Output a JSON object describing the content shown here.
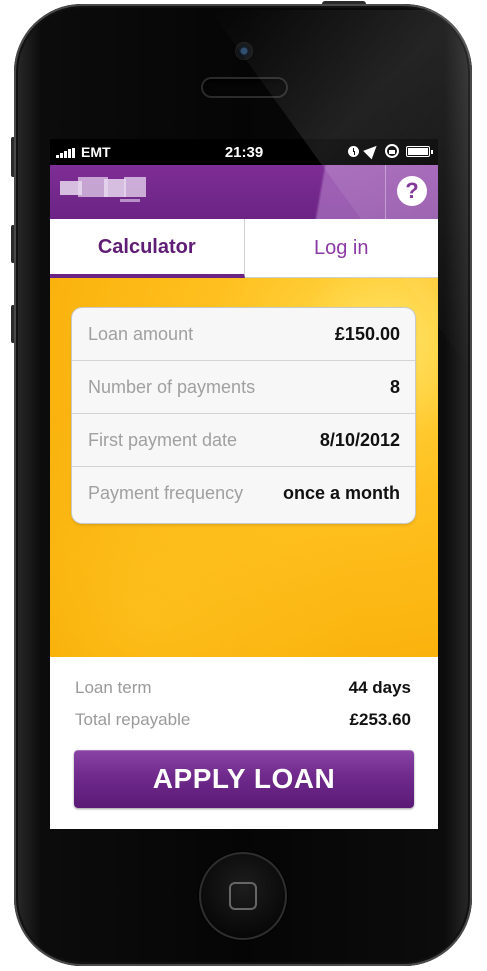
{
  "status_bar": {
    "carrier": "EMT",
    "time": "21:39"
  },
  "header": {
    "help_label": "?"
  },
  "tabs": [
    {
      "label": "Calculator",
      "active": true
    },
    {
      "label": "Log in",
      "active": false
    }
  ],
  "calculator": {
    "rows": [
      {
        "label": "Loan amount",
        "value": "£150.00"
      },
      {
        "label": "Number of payments",
        "value": "8"
      },
      {
        "label": "First payment date",
        "value": "8/10/2012"
      },
      {
        "label": "Payment frequency",
        "value": "once a month"
      }
    ]
  },
  "summary": {
    "loan_term_label": "Loan term",
    "loan_term_value": "44 days",
    "total_label": "Total repayable",
    "total_value": "£253.60"
  },
  "apply_label": "APPLY LOAN",
  "colors": {
    "brand_purple": "#6b2384",
    "accent_yellow": "#ffc01f"
  }
}
